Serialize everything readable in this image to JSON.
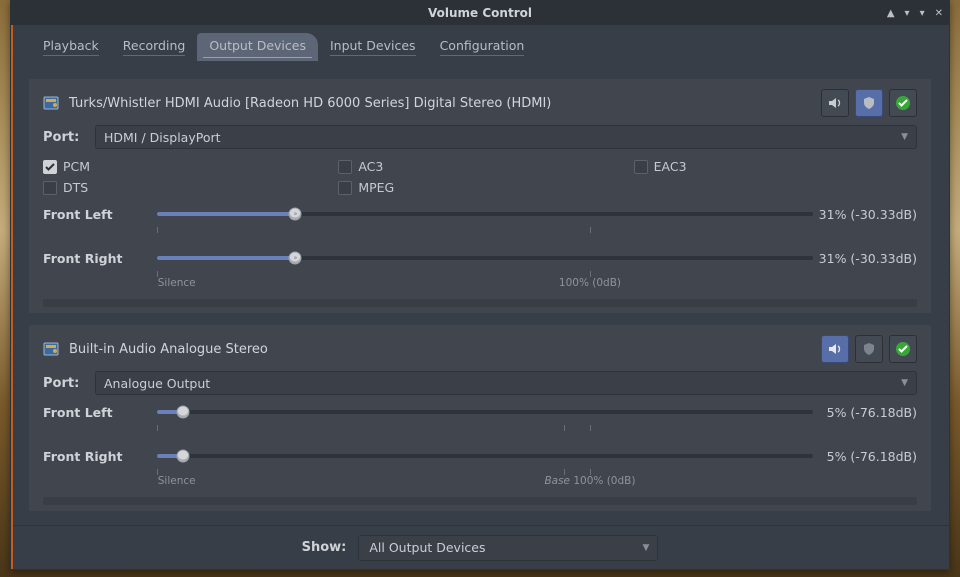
{
  "window": {
    "title": "Volume Control"
  },
  "tabs": [
    {
      "id": "playback",
      "label": "Playback",
      "active": false
    },
    {
      "id": "recording",
      "label": "Recording",
      "active": false
    },
    {
      "id": "output-devices",
      "label": "Output Devices",
      "active": true
    },
    {
      "id": "input-devices",
      "label": "Input Devices",
      "active": false
    },
    {
      "id": "configuration",
      "label": "Configuration",
      "active": false
    }
  ],
  "devices": [
    {
      "id": "hdmi",
      "title": "Turks/Whistler HDMI Audio [Radeon HD 6000 Series] Digital Stereo (HDMI)",
      "port_label": "Port:",
      "port_value": "HDMI / DisplayPort",
      "mute_on": false,
      "lock_on": true,
      "default_on": true,
      "codecs": [
        {
          "label": "PCM",
          "checked": true
        },
        {
          "label": "AC3",
          "checked": false
        },
        {
          "label": "EAC3",
          "checked": false
        },
        {
          "label": "DTS",
          "checked": false
        },
        {
          "label": "MPEG",
          "checked": false
        }
      ],
      "channels": [
        {
          "name": "Front Left",
          "percent": 31,
          "value_text": "31% (-30.33dB)"
        },
        {
          "name": "Front Right",
          "percent": 31,
          "value_text": "31% (-30.33dB)"
        }
      ],
      "scale": {
        "silence": {
          "pct": 0,
          "label": "Silence"
        },
        "hundred": {
          "pct": 66,
          "label": "100% (0dB)"
        },
        "base": null
      }
    },
    {
      "id": "analog",
      "title": "Built-in Audio Analogue Stereo",
      "port_label": "Port:",
      "port_value": "Analogue Output",
      "mute_on": true,
      "lock_on": false,
      "default_on": true,
      "codecs": [],
      "channels": [
        {
          "name": "Front Left",
          "percent": 5,
          "value_text": "5% (-76.18dB)"
        },
        {
          "name": "Front Right",
          "percent": 5,
          "value_text": "5% (-76.18dB)"
        }
      ],
      "scale": {
        "silence": {
          "pct": 0,
          "label": "Silence"
        },
        "hundred": {
          "pct": 66,
          "prefix": "Base ",
          "label": "100% (0dB)"
        },
        "base": {
          "pct": 62
        }
      }
    }
  ],
  "footer": {
    "show_label": "Show:",
    "select_value": "All Output Devices"
  }
}
